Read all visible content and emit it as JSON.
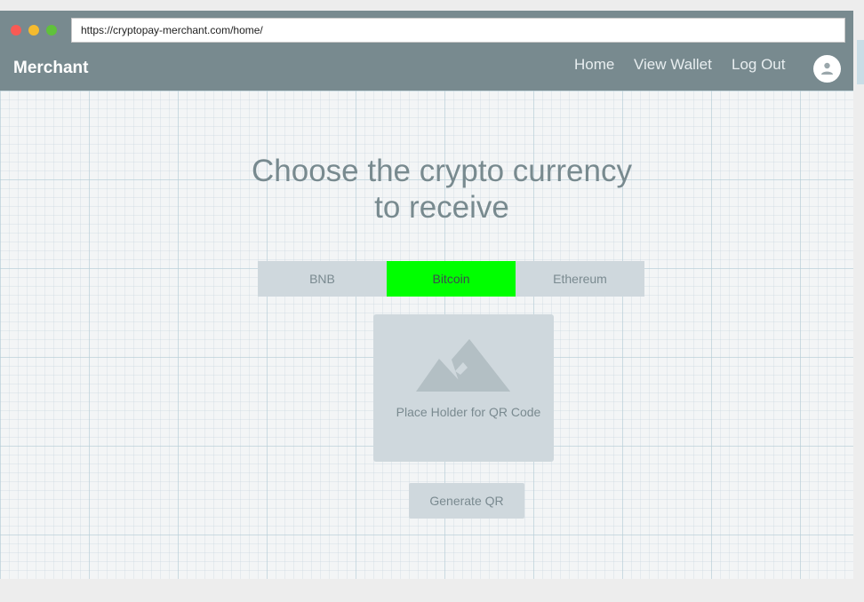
{
  "browser": {
    "url": "https://cryptopay-merchant.com/home/"
  },
  "navbar": {
    "brand": "Merchant",
    "links": [
      "Home",
      "View Wallet",
      "Log Out"
    ],
    "avatar_icon": "user-icon"
  },
  "main": {
    "heading_line1": "Choose the crypto currency",
    "heading_line2": "to receive",
    "currency_tabs": [
      {
        "label": "BNB",
        "selected": false
      },
      {
        "label": "Bitcoin",
        "selected": true
      },
      {
        "label": "Ethereum",
        "selected": false
      }
    ],
    "qr_placeholder": {
      "icon": "image-placeholder-icon",
      "label": "Place Holder for QR Code"
    },
    "generate_button": "Generate QR"
  },
  "colors": {
    "navbar": "#788a8f",
    "selected_tab": "#00ff00",
    "control_bg": "#cfd8dd"
  }
}
